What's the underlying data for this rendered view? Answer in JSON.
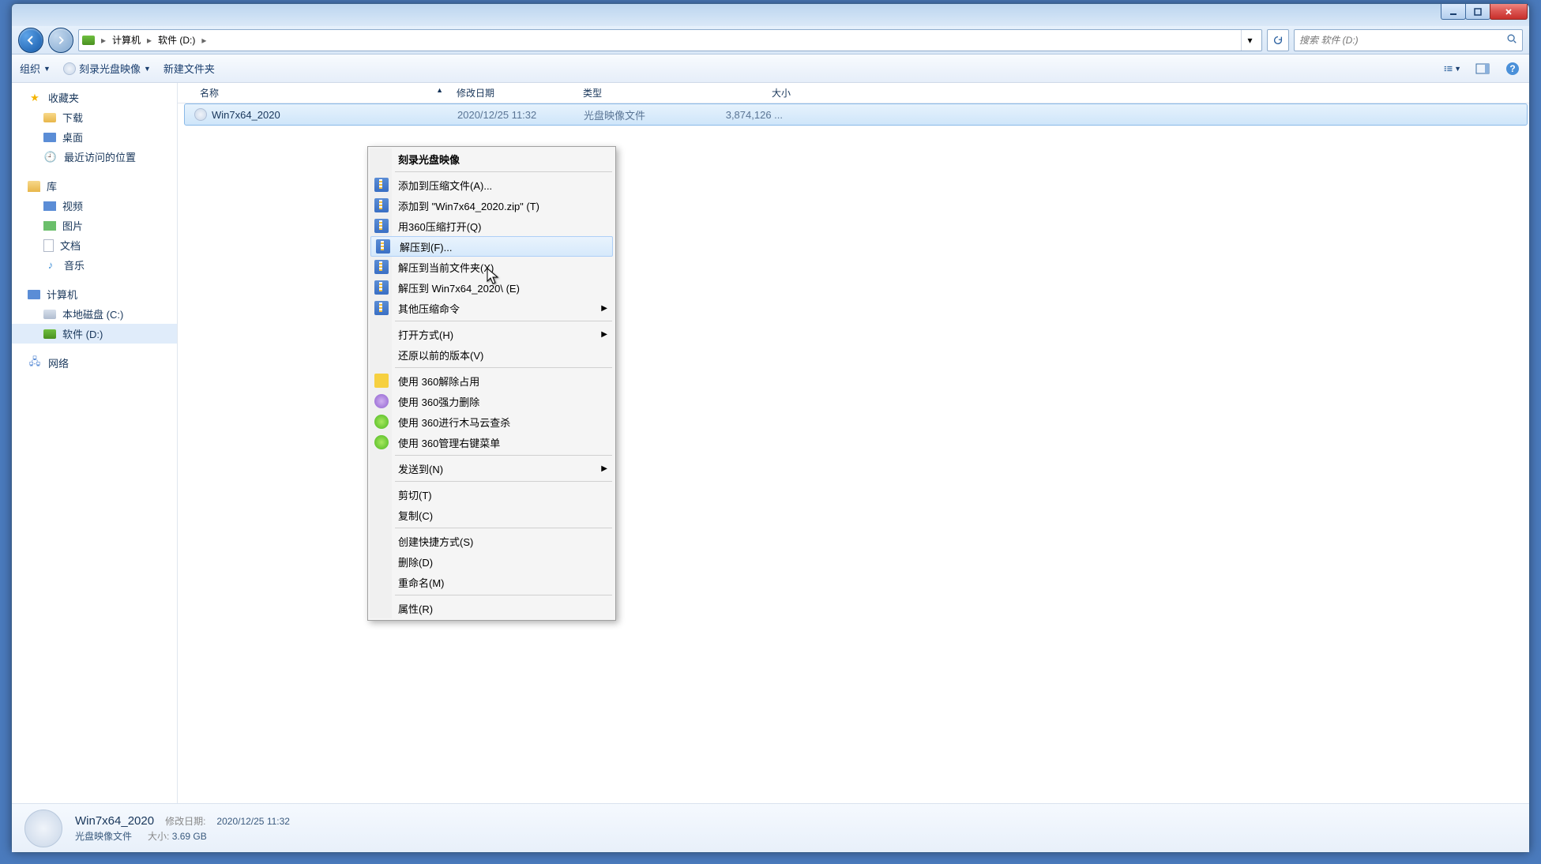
{
  "breadcrumb": {
    "root_icon": "drive-icon",
    "parts": [
      "计算机",
      "软件 (D:)"
    ]
  },
  "search": {
    "placeholder": "搜索 软件 (D:)"
  },
  "toolbar": {
    "organize": "组织",
    "burn": "刻录光盘映像",
    "new_folder": "新建文件夹"
  },
  "columns": {
    "name": "名称",
    "date": "修改日期",
    "type": "类型",
    "size": "大小"
  },
  "sidebar": {
    "favorites": {
      "label": "收藏夹",
      "items": [
        "下载",
        "桌面",
        "最近访问的位置"
      ]
    },
    "libraries": {
      "label": "库",
      "items": [
        "视频",
        "图片",
        "文档",
        "音乐"
      ]
    },
    "computer": {
      "label": "计算机",
      "items": [
        "本地磁盘 (C:)",
        "软件 (D:)"
      ],
      "selected": 1
    },
    "network": {
      "label": "网络"
    }
  },
  "files": [
    {
      "name": "Win7x64_2020",
      "date": "2020/12/25 11:32",
      "type": "光盘映像文件",
      "size": "3,874,126 ..."
    }
  ],
  "details": {
    "name": "Win7x64_2020",
    "type": "光盘映像文件",
    "date_label": "修改日期:",
    "date": "2020/12/25 11:32",
    "size_label": "大小:",
    "size": "3.69 GB"
  },
  "context_menu": {
    "burn": "刻录光盘映像",
    "add_archive": "添加到压缩文件(A)...",
    "add_zip": "添加到 \"Win7x64_2020.zip\" (T)",
    "open_360zip": "用360压缩打开(Q)",
    "extract_to": "解压到(F)...",
    "extract_here": "解压到当前文件夹(X)",
    "extract_named": "解压到 Win7x64_2020\\ (E)",
    "other_zip": "其他压缩命令",
    "open_with": "打开方式(H)",
    "restore": "还原以前的版本(V)",
    "unlock_360": "使用 360解除占用",
    "force_del_360": "使用 360强力删除",
    "trojan_360": "使用 360进行木马云查杀",
    "manage_menu_360": "使用 360管理右键菜单",
    "send_to": "发送到(N)",
    "cut": "剪切(T)",
    "copy": "复制(C)",
    "shortcut": "创建快捷方式(S)",
    "delete": "删除(D)",
    "rename": "重命名(M)",
    "properties": "属性(R)"
  }
}
